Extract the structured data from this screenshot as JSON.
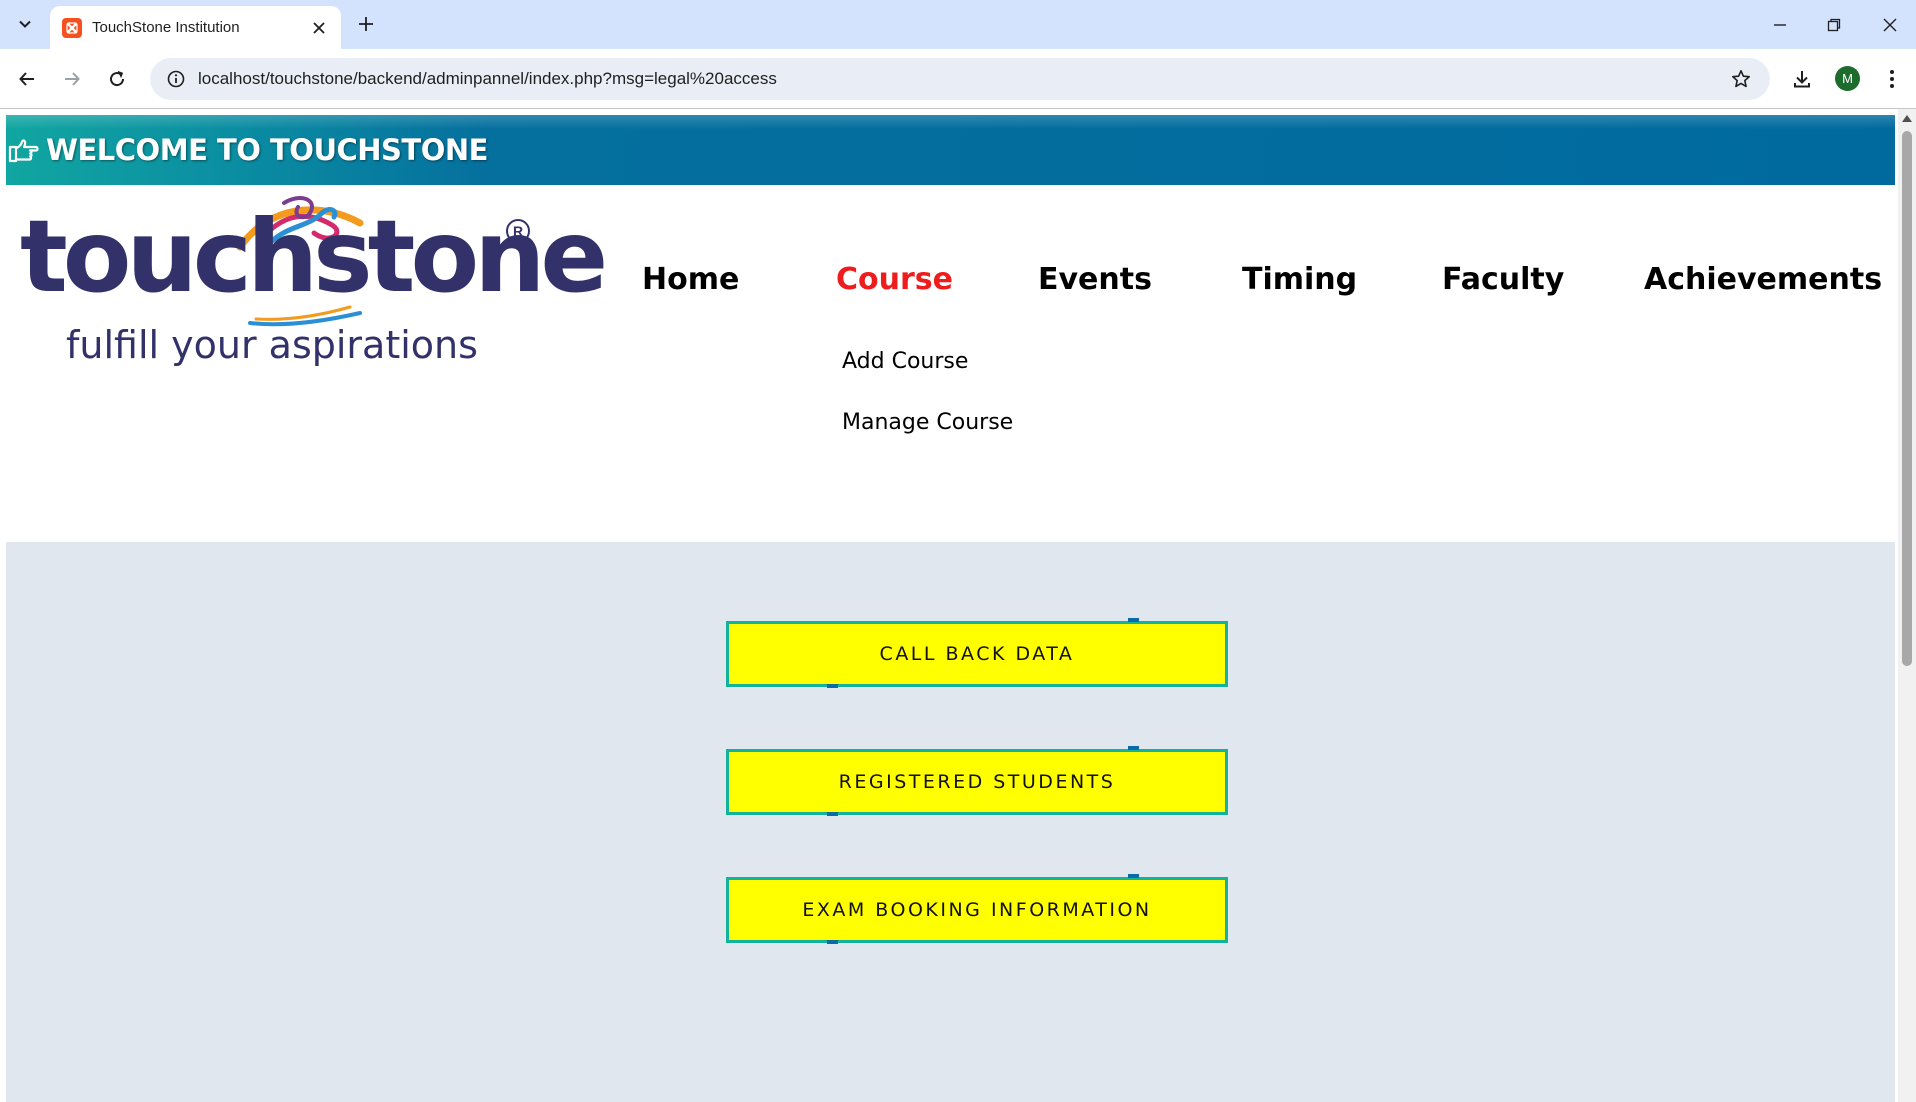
{
  "browser": {
    "tab_title": "TouchStone Institution",
    "url": "localhost/touchstone/backend/adminpannel/index.php?msg=legal%20access",
    "profile_initial": "M"
  },
  "page": {
    "banner": {
      "title": "WELCOME TO TOUCHSTONE",
      "icon": "pointing-hand-icon"
    },
    "logo": {
      "wordmark": "touchstone",
      "registered_mark": "R",
      "tagline": "fulfill your aspirations"
    },
    "nav": {
      "items": [
        {
          "label": "Home"
        },
        {
          "label": "Course"
        },
        {
          "label": "Events"
        },
        {
          "label": "Timing"
        },
        {
          "label": "Faculty"
        },
        {
          "label": "Achievements"
        }
      ],
      "active_item": "Course",
      "submenu": [
        "Add Course",
        "Manage Course"
      ]
    },
    "actions": [
      {
        "label": "CALL BACK DATA"
      },
      {
        "label": "REGISTERED STUDENTS"
      },
      {
        "label": "EXAM BOOKING INFORMATION"
      }
    ]
  },
  "colors": {
    "banner_start": "#11a6a1",
    "banner_end": "#006a9f",
    "logo_text": "#33316a",
    "nav_active": "#ee1c1c",
    "action_fill": "#ffff00",
    "action_border": "#12b39a",
    "content_bg": "#e0e7ee"
  }
}
